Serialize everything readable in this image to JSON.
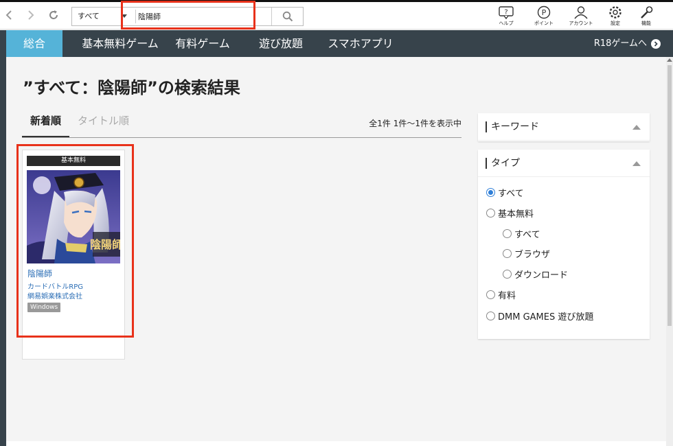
{
  "toolbar": {
    "category": "すべて",
    "search_value": "陰陽師",
    "icons": [
      {
        "name": "help",
        "label": "ヘルプ"
      },
      {
        "name": "point",
        "label": "ポイント"
      },
      {
        "name": "account",
        "label": "アカウント"
      },
      {
        "name": "settings",
        "label": "設定"
      },
      {
        "name": "function",
        "label": "機能"
      }
    ]
  },
  "nav": {
    "items": [
      {
        "label": "総合",
        "active": true
      },
      {
        "label": "基本無料ゲーム",
        "active": false
      },
      {
        "label": "有料ゲーム",
        "active": false
      },
      {
        "label": "遊び放題",
        "active": false
      },
      {
        "label": "スマホアプリ",
        "active": false
      }
    ],
    "r18": "R18ゲームへ"
  },
  "page": {
    "title": "”すべて：陰陽師”の検索結果",
    "sort_tabs": [
      {
        "label": "新着順",
        "active": true
      },
      {
        "label": "タイトル順",
        "active": false
      }
    ],
    "result_count": "全1件 1件～1件を表示中"
  },
  "results": [
    {
      "badge": "基本無料",
      "title": "陰陽師",
      "genre": "カードバトルRPG",
      "maker": "網易娯楽株式会社",
      "platform": "Windows",
      "logo_text": "陰陽師"
    }
  ],
  "filters": {
    "keyword": {
      "title": "キーワード"
    },
    "type": {
      "title": "タイプ",
      "options": [
        {
          "label": "すべて",
          "checked": true,
          "indent": 0
        },
        {
          "label": "基本無料",
          "checked": false,
          "indent": 0
        },
        {
          "label": "すべて",
          "checked": false,
          "indent": 1
        },
        {
          "label": "ブラウザ",
          "checked": false,
          "indent": 1
        },
        {
          "label": "ダウンロード",
          "checked": false,
          "indent": 1
        },
        {
          "label": "有料",
          "checked": false,
          "indent": 0
        },
        {
          "label": "DMM GAMES 遊び放題",
          "checked": false,
          "indent": 0
        }
      ]
    }
  },
  "colors": {
    "nav_bg": "#37434b",
    "nav_active": "#55b3d8",
    "link": "#2a6db5",
    "highlight": "#e8311a"
  }
}
